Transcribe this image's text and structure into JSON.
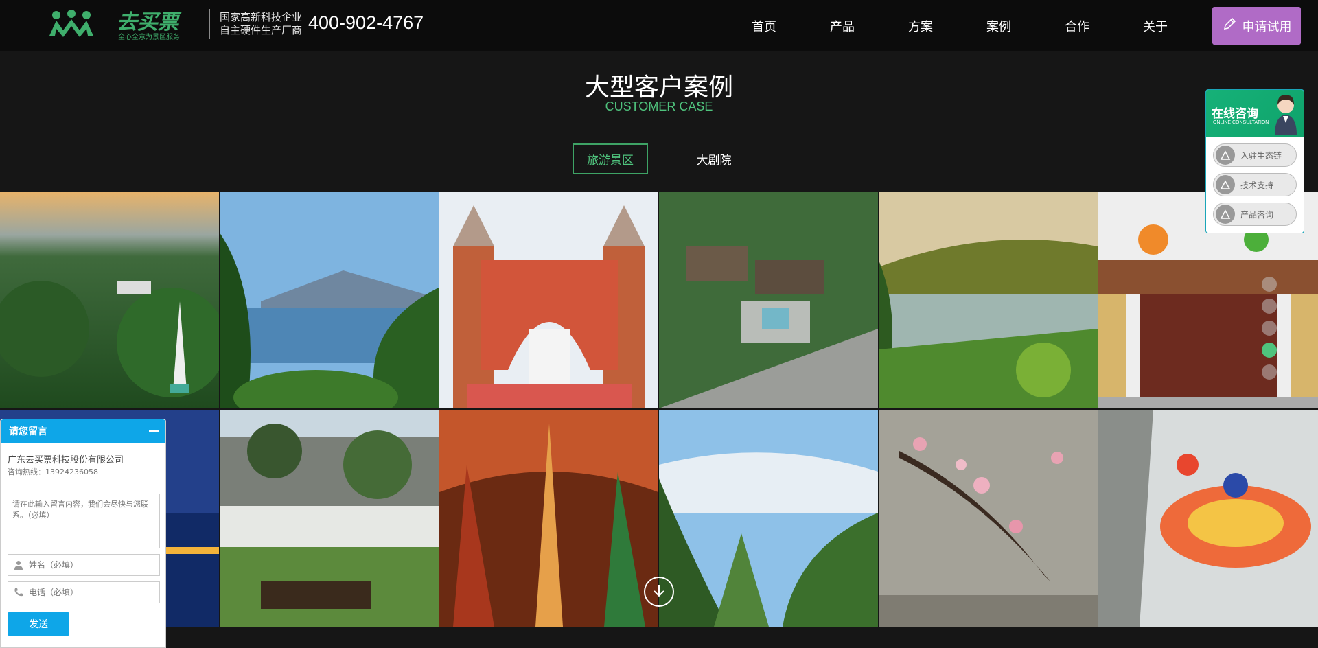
{
  "header": {
    "logo_text": "去买票",
    "logo_slogan": "全心全意为景区服务",
    "tagline_line1": "国家高新科技企业",
    "tagline_line2": "自主硬件生产厂商",
    "phone": "400-902-4767",
    "nav": [
      {
        "label": "首页"
      },
      {
        "label": "产品"
      },
      {
        "label": "方案"
      },
      {
        "label": "案例"
      },
      {
        "label": "合作"
      },
      {
        "label": "关于"
      }
    ],
    "trial_button": "申请试用"
  },
  "section": {
    "title": "大型客户案例",
    "subtitle": "CUSTOMER CASE",
    "tabs": [
      {
        "label": "旅游景区",
        "active": true
      },
      {
        "label": "大剧院",
        "active": false
      }
    ]
  },
  "consult": {
    "title": "在线咨询",
    "subtitle": "ONLINE CONSULTATION",
    "items": [
      {
        "label": "入驻生态链"
      },
      {
        "label": "技术支持"
      },
      {
        "label": "产品咨询"
      }
    ]
  },
  "message": {
    "title": "请您留言",
    "company": "广东去买票科技股份有限公司",
    "hotline": "咨询热线：13924236058",
    "content_placeholder": "请在此输入留言内容，我们会尽快与您联系。（必填）",
    "name_placeholder": "姓名（必填）",
    "phone_placeholder": "电话（必填）",
    "send": "发送"
  },
  "colors": {
    "accent_green": "#4fc37d",
    "trial_purple": "#b06bc6",
    "message_blue": "#0ea6e8"
  },
  "slider": {
    "count": 5,
    "active_index": 4
  }
}
